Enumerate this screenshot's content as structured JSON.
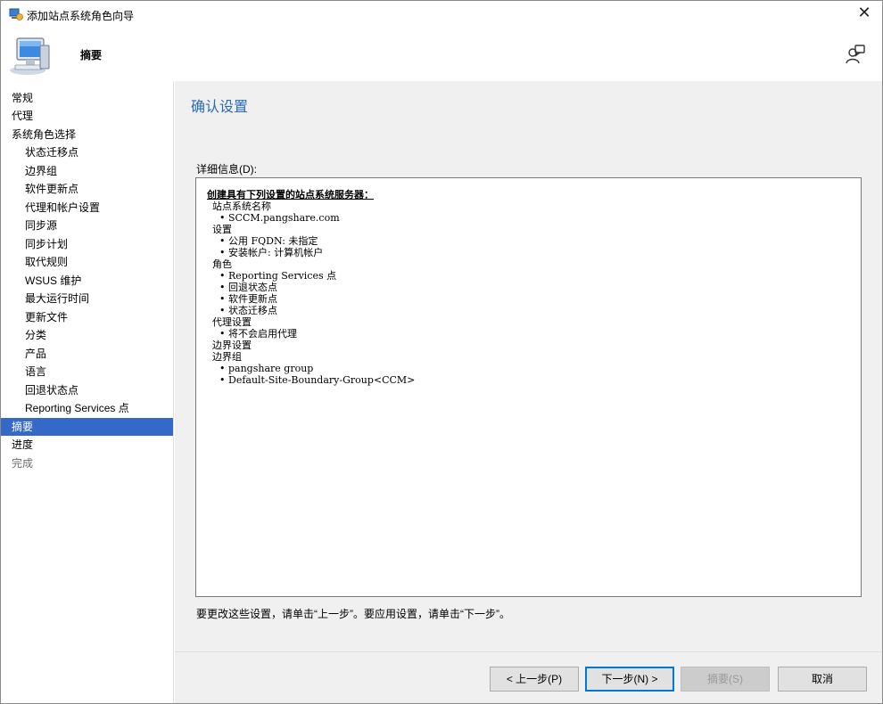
{
  "window": {
    "title": "添加站点系统角色向导",
    "close_glyph": "✕"
  },
  "header": {
    "page_label": "摘要",
    "icon": "computer-icon",
    "help_icon": "help-person-icon"
  },
  "nav": {
    "items": [
      {
        "label": "常规",
        "level": 0,
        "state": "normal"
      },
      {
        "label": "代理",
        "level": 0,
        "state": "normal"
      },
      {
        "label": "系统角色选择",
        "level": 0,
        "state": "normal"
      },
      {
        "label": "状态迁移点",
        "level": 1,
        "state": "normal"
      },
      {
        "label": "边界组",
        "level": 1,
        "state": "normal"
      },
      {
        "label": "软件更新点",
        "level": 1,
        "state": "normal"
      },
      {
        "label": "代理和帐户设置",
        "level": 1,
        "state": "normal"
      },
      {
        "label": "同步源",
        "level": 1,
        "state": "normal"
      },
      {
        "label": "同步计划",
        "level": 1,
        "state": "normal"
      },
      {
        "label": "取代规则",
        "level": 1,
        "state": "normal"
      },
      {
        "label": "WSUS 维护",
        "level": 1,
        "state": "normal"
      },
      {
        "label": "最大运行时间",
        "level": 1,
        "state": "normal"
      },
      {
        "label": "更新文件",
        "level": 1,
        "state": "normal"
      },
      {
        "label": "分类",
        "level": 1,
        "state": "normal"
      },
      {
        "label": "产品",
        "level": 1,
        "state": "normal"
      },
      {
        "label": "语言",
        "level": 1,
        "state": "normal"
      },
      {
        "label": "回退状态点",
        "level": 1,
        "state": "normal"
      },
      {
        "label": "Reporting Services 点",
        "level": 1,
        "state": "normal"
      },
      {
        "label": "摘要",
        "level": 0,
        "state": "active"
      },
      {
        "label": "进度",
        "level": 0,
        "state": "normal"
      },
      {
        "label": "完成",
        "level": 0,
        "state": "disabled"
      }
    ]
  },
  "main": {
    "heading": "确认设置",
    "details_label": "详细信息(D):",
    "summary_title": "创建具有下列设置的站点系统服务器：",
    "details": [
      {
        "text": "站点系统名称",
        "level": 1
      },
      {
        "text": "SCCM.pangshare.com",
        "level": 2
      },
      {
        "text": "设置",
        "level": 1
      },
      {
        "text": "公用 FQDN: 未指定",
        "level": 2
      },
      {
        "text": "安装帐户: 计算机帐户",
        "level": 2
      },
      {
        "text": "角色",
        "level": 1
      },
      {
        "text": "Reporting Services 点",
        "level": 2
      },
      {
        "text": "回退状态点",
        "level": 2
      },
      {
        "text": "软件更新点",
        "level": 2
      },
      {
        "text": "状态迁移点",
        "level": 2
      },
      {
        "text": "代理设置",
        "level": 1
      },
      {
        "text": "将不会启用代理",
        "level": 2
      },
      {
        "text": "边界设置",
        "level": 1
      },
      {
        "text": "边界组",
        "level": 1
      },
      {
        "text": "pangshare group",
        "level": 2
      },
      {
        "text": "Default-Site-Boundary-Group<CCM>",
        "level": 2
      }
    ],
    "hint": "要更改这些设置，请单击“上一步”。要应用设置，请单击“下一步”。"
  },
  "buttons": {
    "prev": "< 上一步(P)",
    "next": "下一步(N) >",
    "summary": "摘要(S)",
    "cancel": "取消"
  },
  "colors": {
    "accent": "#3569c8",
    "heading": "#2a6bb8",
    "panel_bg": "#f0f0f0"
  }
}
